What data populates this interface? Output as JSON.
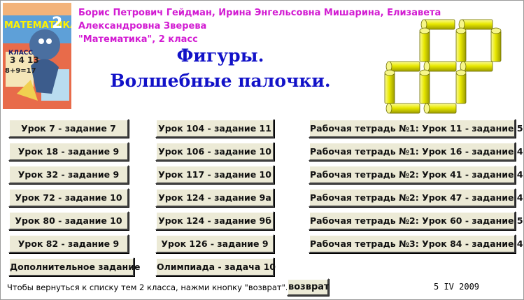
{
  "header": {
    "authors": "Борис Петрович Гейдман, Ирина Энгельсовна Мишарина, Елизавета Александровна Зверева",
    "book": "\"Математика\", 2 класс",
    "title_line1": "Фигуры.",
    "title_line2": "Волшебные палочки."
  },
  "cover": {
    "label": "МАТЕМАТИКА",
    "grade": "2",
    "class_word": "КЛАСС",
    "formula": "8+9=17",
    "numbers": "3 4 13"
  },
  "buttons": {
    "col1": [
      "Урок 7 - задание 7",
      "Урок 18 - задание 9",
      "Урок 32 - задание 9",
      "Урок 72 - задание 10",
      "Урок 80 - задание 10",
      "Урок 82 - задание 9",
      "Дополнительное задание"
    ],
    "col2": [
      "Урок 104 - задание 11",
      "Урок 106 - задание 10",
      "Урок 117 - задание 10",
      "Урок 124 - задание 9а",
      "Урок 124 - задание 9б",
      "Урок 126 - задание 9",
      "Олимпиада - задача 10"
    ],
    "col3": [
      "Рабочая тетрадь №1: Урок 11 - задание 5",
      "Рабочая тетрадь №1: Урок 16 - задание 4",
      "Рабочая тетрадь №2: Урок 41 - задание 4",
      "Рабочая тетрадь №2: Урок 47 - задание 4",
      "Рабочая тетрадь №2: Урок 60 - задание 5",
      "Рабочая тетрадь №3: Урок 84 - задание 4"
    ]
  },
  "footer": {
    "hint": "Чтобы вернуться к списку тем 2 класса, нажми кнопку \"возврат\".",
    "back_label": "возврат",
    "date": "5 IV 2009"
  },
  "colors": {
    "authors": "#d21bd2",
    "title": "#1212c8",
    "stick": "#e8e800",
    "button_face": "#ecead6"
  }
}
